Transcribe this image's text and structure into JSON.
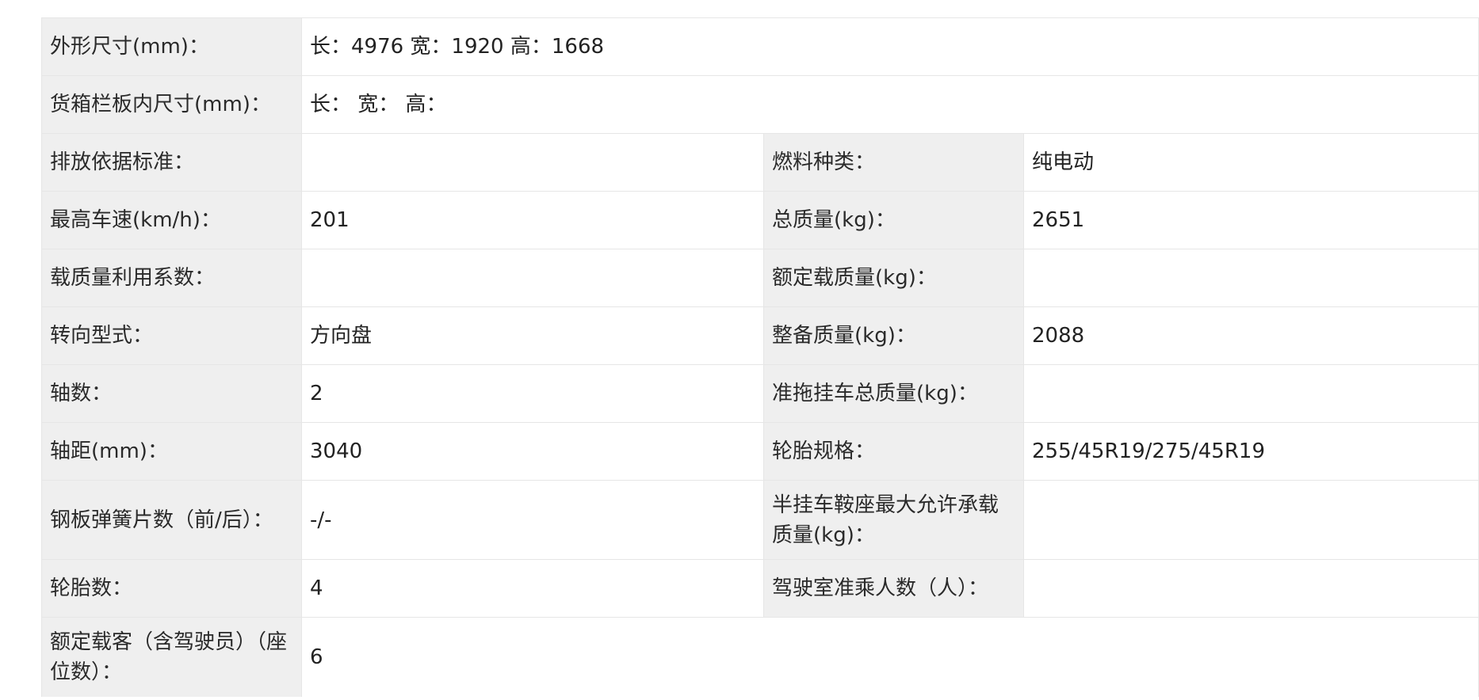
{
  "rows": [
    {
      "label": "外形尺寸(mm)：",
      "value": "长：4976 宽：1920 高：1668"
    },
    {
      "label": "货箱栏板内尺寸(mm)：",
      "value": "长：  宽：  高："
    },
    {
      "label": "排放依据标准：",
      "value": "",
      "label2": "燃料种类：",
      "value2": "纯电动"
    },
    {
      "label": "最高车速(km/h)：",
      "value": "201",
      "label2": "总质量(kg)：",
      "value2": "2651"
    },
    {
      "label": "载质量利用系数：",
      "value": "",
      "label2": "额定载质量(kg)：",
      "value2": ""
    },
    {
      "label": "转向型式：",
      "value": "方向盘",
      "label2": "整备质量(kg)：",
      "value2": "2088"
    },
    {
      "label": "轴数：",
      "value": "2",
      "label2": "准拖挂车总质量(kg)：",
      "value2": ""
    },
    {
      "label": "轴距(mm)：",
      "value": "3040",
      "label2": "轮胎规格：",
      "value2": "255/45R19/275/45R19"
    },
    {
      "label": "钢板弹簧片数（前/后）：",
      "value": "-/-",
      "label2": "半挂车鞍座最大允许承载质量(kg)：",
      "value2": ""
    },
    {
      "label": "轮胎数：",
      "value": "4",
      "label2": "驾驶室准乘人数（人）：",
      "value2": ""
    },
    {
      "label": "额定载客（含驾驶员）（座位数）：",
      "value": "6"
    }
  ]
}
